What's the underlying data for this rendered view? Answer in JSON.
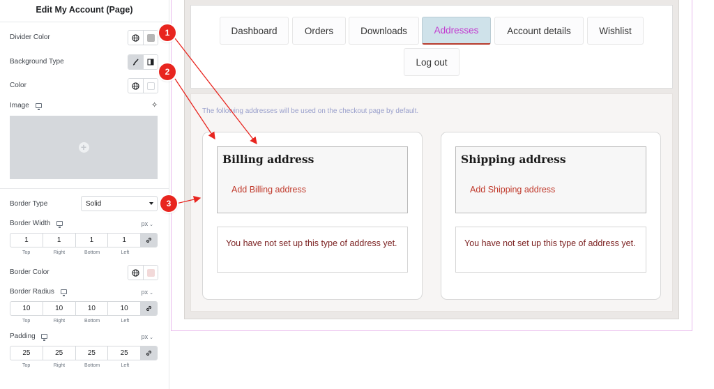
{
  "panel": {
    "title": "Edit My Account (Page)",
    "divider_color": {
      "label": "Divider Color",
      "global_icon": "globe-icon",
      "swatch": "#b5b5b5"
    },
    "background_type": {
      "label": "Background Type",
      "options": [
        "classic-brush-icon",
        "gradient-icon"
      ],
      "active": "classic-brush-icon"
    },
    "color": {
      "label": "Color",
      "global_icon": "globe-icon",
      "swatch": "#ffffff"
    },
    "image": {
      "label": "Image",
      "device_icon": "monitor-icon",
      "ai_icon": "sparkle-icon",
      "placeholder_icon": "plus-icon"
    },
    "border_type": {
      "label": "Border Type",
      "value": "Solid"
    },
    "border_width": {
      "label": "Border Width",
      "unit": "px",
      "values": [
        "1",
        "1",
        "1",
        "1"
      ],
      "labels": [
        "Top",
        "Right",
        "Bottom",
        "Left"
      ]
    },
    "border_color": {
      "label": "Border Color",
      "global_icon": "globe-icon",
      "swatch": "#f2d9d9"
    },
    "border_radius": {
      "label": "Border Radius",
      "unit": "px",
      "values": [
        "10",
        "10",
        "10",
        "10"
      ],
      "labels": [
        "Top",
        "Right",
        "Bottom",
        "Left"
      ]
    },
    "padding": {
      "label": "Padding",
      "unit": "px",
      "values": [
        "25",
        "25",
        "25",
        "25"
      ],
      "labels": [
        "Top",
        "Right",
        "Bottom",
        "Left"
      ]
    }
  },
  "preview": {
    "tabs": [
      "Dashboard",
      "Orders",
      "Downloads",
      "Addresses",
      "Account details",
      "Wishlist",
      "Log out"
    ],
    "active_tab": "Addresses",
    "notice": "The following addresses will be used on the checkout page by default.",
    "billing": {
      "title": "Billing address",
      "add_link": "Add Billing address",
      "message": "You have not set up this type of address yet."
    },
    "shipping": {
      "title": "Shipping address",
      "add_link": "Add Shipping address",
      "message": "You have not set up this type of address yet."
    }
  },
  "annotations": [
    "1",
    "2",
    "3"
  ],
  "colors": {
    "accent_red": "#e8251f",
    "active_tab_text": "#c23ad0",
    "link_red": "#c0392b"
  }
}
